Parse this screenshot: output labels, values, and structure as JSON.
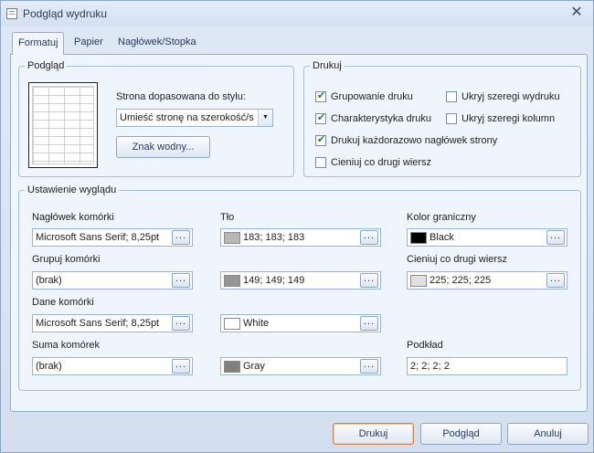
{
  "window": {
    "title": "Podgląd wydruku"
  },
  "tabs": [
    {
      "label": "Formatuj",
      "active": true
    },
    {
      "label": "Papier",
      "active": false
    },
    {
      "label": "Nagłówek/Stopka",
      "active": false
    }
  ],
  "preview_group": {
    "legend": "Podgląd",
    "fit_label": "Strona dopasowana do stylu:",
    "fit_value": "Umieść stronę na szerokość/s",
    "watermark_button": "Znak wodny..."
  },
  "print_group": {
    "legend": "Drukuj",
    "options": [
      {
        "label": "Grupowanie druku",
        "checked": true
      },
      {
        "label": "Ukryj szeregi wydruku",
        "checked": false
      },
      {
        "label": "Charakterystyka druku",
        "checked": true
      },
      {
        "label": "Ukryj szeregi kolumn",
        "checked": false
      },
      {
        "label": "Drukuj każdorazowo nagłówek strony",
        "checked": true
      },
      {
        "label": "Cieniuj co drugi wiersz",
        "checked": false
      }
    ]
  },
  "appearance": {
    "legend": "Ustawienie wyglądu",
    "ellipsis": "...",
    "header_cell": {
      "label": "Nagłówek komórki",
      "value": "Microsoft Sans Serif; 8,25pt"
    },
    "background": {
      "label": "Tło",
      "value": "183; 183; 183",
      "color": "#b7b7b7"
    },
    "border_color": {
      "label": "Kolor graniczny",
      "value": "Black",
      "color": "#000000"
    },
    "group_cell": {
      "label": "Grupuj komórki",
      "value": "(brak)"
    },
    "group_bg": {
      "value": "149; 149; 149",
      "color": "#959595"
    },
    "shade_row": {
      "label": "Cieniuj co drugi wiersz",
      "value": "225; 225; 225",
      "color": "#e1e1e1"
    },
    "data_cell": {
      "label": "Dane komórki",
      "value": "Microsoft Sans Serif; 8,25pt"
    },
    "data_bg": {
      "value": "White",
      "color": "#ffffff"
    },
    "sum_cell": {
      "label": "Suma komórek",
      "value": "(brak)"
    },
    "sum_bg": {
      "value": "Gray",
      "color": "#808080"
    },
    "padding": {
      "label": "Podkład",
      "value": "2; 2; 2; 2"
    }
  },
  "buttons": {
    "print": "Drukuj",
    "preview": "Podgląd",
    "cancel": "Anuluj"
  }
}
